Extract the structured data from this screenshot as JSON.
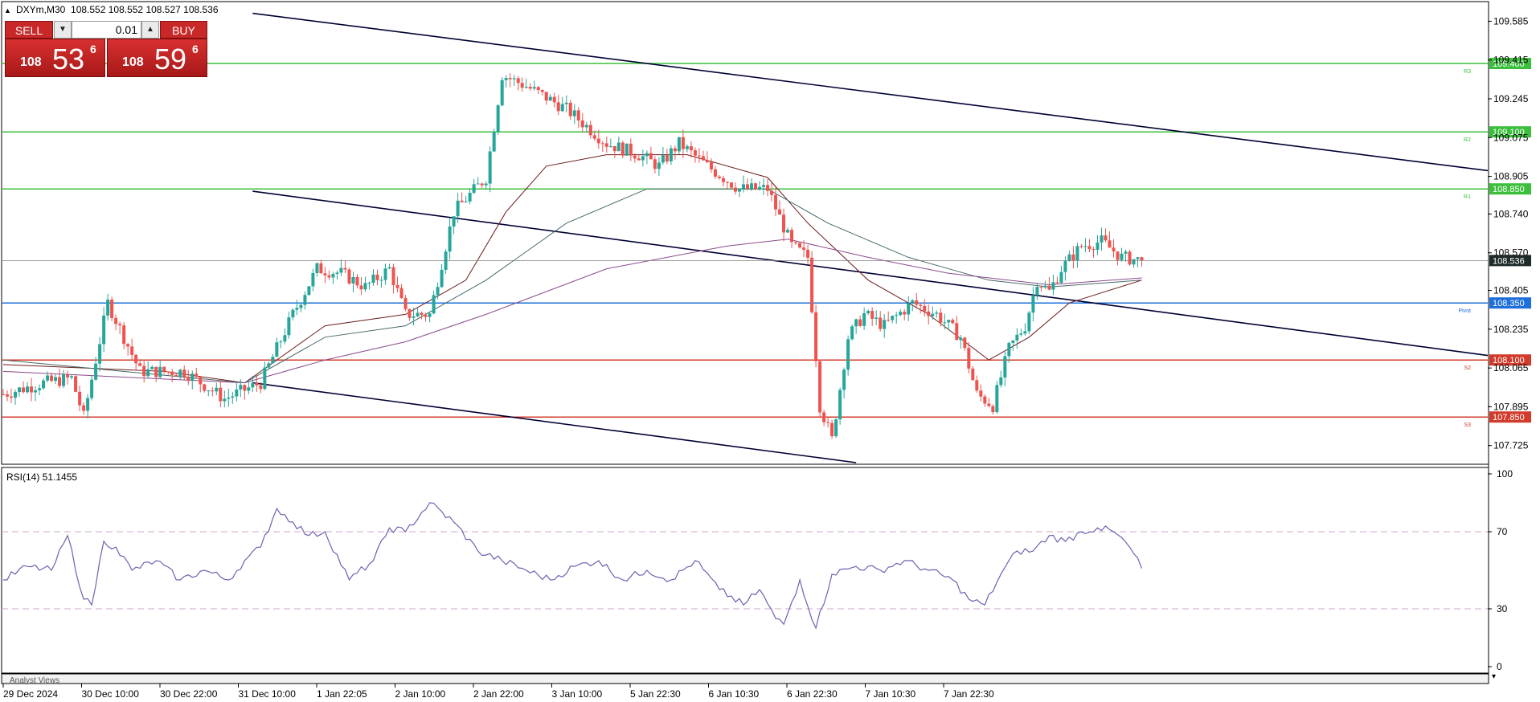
{
  "symbol_header": "DXYm,M30  108.552 108.552 108.527 108.536",
  "trade_panel": {
    "sell_label": "SELL",
    "buy_label": "BUY",
    "lot_value": "0.01",
    "sell_price": {
      "small": "108",
      "big": "53",
      "sup": "6"
    },
    "buy_price": {
      "small": "108",
      "big": "59",
      "sup": "6"
    }
  },
  "colors": {
    "bull_candle": "#26a69a",
    "bear_candle": "#ef5350",
    "resistance": "#3cbf3c",
    "support": "#d23b2b",
    "pivot": "#1e6fd9",
    "channel": "#000033",
    "rsi": "#7060b0"
  },
  "chart_data": [
    {
      "type": "candlestick",
      "timeframe": "M30",
      "ylim": [
        107.65,
        109.65
      ],
      "y_ticks": [
        "109.585",
        "109.415",
        "109.245",
        "109.075",
        "108.905",
        "108.740",
        "108.570",
        "108.405",
        "108.235",
        "108.065",
        "107.895",
        "107.725"
      ],
      "x_ticks": [
        "29 Dec 2024",
        "30 Dec 10:00",
        "30 Dec 22:00",
        "31 Dec 10:00",
        "1 Jan 22:05",
        "2 Jan 10:00",
        "2 Jan 22:00",
        "3 Jan 10:00",
        "5 Jan 22:30",
        "6 Jan 10:30",
        "6 Jan 22:30",
        "7 Jan 10:30",
        "7 Jan 22:30"
      ],
      "current_price": "108.536",
      "levels": [
        {
          "tag": "R3",
          "value": 109.4,
          "label": "109.400",
          "kind": "resistance"
        },
        {
          "tag": "R2",
          "value": 109.1,
          "label": "109.100",
          "kind": "resistance"
        },
        {
          "tag": "R1",
          "value": 108.85,
          "label": "108.850",
          "kind": "resistance"
        },
        {
          "tag": "Pivot",
          "value": 108.35,
          "label": "108.350",
          "kind": "pivot"
        },
        {
          "tag": "S2",
          "value": 108.1,
          "label": "108.100",
          "kind": "support"
        },
        {
          "tag": "S3",
          "value": 107.85,
          "label": "107.850",
          "kind": "support"
        }
      ],
      "key_closes": [
        {
          "t": 0,
          "v": 107.95
        },
        {
          "t": 10,
          "v": 108.0
        },
        {
          "t": 17,
          "v": 108.02
        },
        {
          "t": 20,
          "v": 107.85
        },
        {
          "t": 26,
          "v": 108.35
        },
        {
          "t": 34,
          "v": 108.05
        },
        {
          "t": 45,
          "v": 108.05
        },
        {
          "t": 55,
          "v": 107.93
        },
        {
          "t": 64,
          "v": 108.0
        },
        {
          "t": 72,
          "v": 108.3
        },
        {
          "t": 78,
          "v": 108.5
        },
        {
          "t": 84,
          "v": 108.48
        },
        {
          "t": 90,
          "v": 108.42
        },
        {
          "t": 96,
          "v": 108.5
        },
        {
          "t": 100,
          "v": 108.3
        },
        {
          "t": 106,
          "v": 108.3
        },
        {
          "t": 112,
          "v": 108.75
        },
        {
          "t": 120,
          "v": 108.9
        },
        {
          "t": 124,
          "v": 109.35
        },
        {
          "t": 130,
          "v": 109.3
        },
        {
          "t": 140,
          "v": 109.2
        },
        {
          "t": 150,
          "v": 109.05
        },
        {
          "t": 158,
          "v": 109.0
        },
        {
          "t": 163,
          "v": 108.95
        },
        {
          "t": 168,
          "v": 109.05
        },
        {
          "t": 175,
          "v": 108.95
        },
        {
          "t": 183,
          "v": 108.85
        },
        {
          "t": 190,
          "v": 108.85
        },
        {
          "t": 196,
          "v": 108.6
        },
        {
          "t": 200,
          "v": 108.55
        },
        {
          "t": 203,
          "v": 107.9
        },
        {
          "t": 206,
          "v": 107.75
        },
        {
          "t": 210,
          "v": 108.2
        },
        {
          "t": 214,
          "v": 108.3
        },
        {
          "t": 219,
          "v": 108.25
        },
        {
          "t": 226,
          "v": 108.35
        },
        {
          "t": 232,
          "v": 108.3
        },
        {
          "t": 238,
          "v": 108.2
        },
        {
          "t": 242,
          "v": 107.95
        },
        {
          "t": 246,
          "v": 107.9
        },
        {
          "t": 250,
          "v": 108.15
        },
        {
          "t": 254,
          "v": 108.25
        },
        {
          "t": 257,
          "v": 108.45
        },
        {
          "t": 260,
          "v": 108.4
        },
        {
          "t": 263,
          "v": 108.5
        },
        {
          "t": 268,
          "v": 108.6
        },
        {
          "t": 273,
          "v": 108.62
        },
        {
          "t": 278,
          "v": 108.55
        },
        {
          "t": 283,
          "v": 108.536
        }
      ],
      "moving_averages": [
        {
          "name": "",
          "color": "#6b1c1c",
          "points": [
            {
              "t": 0,
              "v": 108.08
            },
            {
              "t": 40,
              "v": 108.05
            },
            {
              "t": 60,
              "v": 108.0
            },
            {
              "t": 80,
              "v": 108.25
            },
            {
              "t": 100,
              "v": 108.3
            },
            {
              "t": 115,
              "v": 108.45
            },
            {
              "t": 125,
              "v": 108.75
            },
            {
              "t": 135,
              "v": 108.95
            },
            {
              "t": 150,
              "v": 109.0
            },
            {
              "t": 170,
              "v": 109.0
            },
            {
              "t": 190,
              "v": 108.9
            },
            {
              "t": 200,
              "v": 108.7
            },
            {
              "t": 215,
              "v": 108.45
            },
            {
              "t": 230,
              "v": 108.3
            },
            {
              "t": 245,
              "v": 108.1
            },
            {
              "t": 255,
              "v": 108.2
            },
            {
              "t": 265,
              "v": 108.35
            },
            {
              "t": 283,
              "v": 108.45
            }
          ]
        },
        {
          "name": "",
          "color": "#4a6a6a",
          "points": [
            {
              "t": 0,
              "v": 108.1
            },
            {
              "t": 60,
              "v": 108.0
            },
            {
              "t": 80,
              "v": 108.2
            },
            {
              "t": 100,
              "v": 108.25
            },
            {
              "t": 120,
              "v": 108.45
            },
            {
              "t": 140,
              "v": 108.7
            },
            {
              "t": 160,
              "v": 108.85
            },
            {
              "t": 190,
              "v": 108.85
            },
            {
              "t": 205,
              "v": 108.7
            },
            {
              "t": 225,
              "v": 108.55
            },
            {
              "t": 245,
              "v": 108.45
            },
            {
              "t": 260,
              "v": 108.42
            },
            {
              "t": 283,
              "v": 108.45
            }
          ]
        },
        {
          "name": "",
          "color": "#8a4a8a",
          "points": [
            {
              "t": 0,
              "v": 108.05
            },
            {
              "t": 60,
              "v": 108.0
            },
            {
              "t": 80,
              "v": 108.1
            },
            {
              "t": 100,
              "v": 108.18
            },
            {
              "t": 120,
              "v": 108.3
            },
            {
              "t": 150,
              "v": 108.5
            },
            {
              "t": 180,
              "v": 108.6
            },
            {
              "t": 195,
              "v": 108.63
            },
            {
              "t": 215,
              "v": 108.55
            },
            {
              "t": 235,
              "v": 108.48
            },
            {
              "t": 260,
              "v": 108.43
            },
            {
              "t": 283,
              "v": 108.46
            }
          ]
        }
      ],
      "channel_lines": [
        {
          "from": {
            "t": 62,
            "v": 109.62
          },
          "to": {
            "t": 369,
            "v": 108.93
          }
        },
        {
          "from": {
            "t": 62,
            "v": 108.84
          },
          "to": {
            "t": 369,
            "v": 108.12
          }
        },
        {
          "from": {
            "t": 62,
            "v": 108.0
          },
          "to": {
            "t": 212,
            "v": 107.65
          }
        }
      ]
    },
    {
      "type": "line",
      "title": "RSI(14) 51.1455",
      "ylim": [
        0,
        100
      ],
      "y_ticks": [
        "100",
        "70",
        "30",
        "0"
      ],
      "levels": [
        70,
        30
      ],
      "points": [
        {
          "t": 0,
          "v": 45
        },
        {
          "t": 6,
          "v": 52
        },
        {
          "t": 12,
          "v": 50
        },
        {
          "t": 16,
          "v": 68
        },
        {
          "t": 20,
          "v": 35
        },
        {
          "t": 22,
          "v": 32
        },
        {
          "t": 25,
          "v": 65
        },
        {
          "t": 28,
          "v": 62
        },
        {
          "t": 32,
          "v": 50
        },
        {
          "t": 38,
          "v": 55
        },
        {
          "t": 44,
          "v": 45
        },
        {
          "t": 50,
          "v": 50
        },
        {
          "t": 56,
          "v": 45
        },
        {
          "t": 60,
          "v": 55
        },
        {
          "t": 64,
          "v": 62
        },
        {
          "t": 68,
          "v": 82
        },
        {
          "t": 72,
          "v": 75
        },
        {
          "t": 76,
          "v": 68
        },
        {
          "t": 80,
          "v": 70
        },
        {
          "t": 86,
          "v": 45
        },
        {
          "t": 92,
          "v": 55
        },
        {
          "t": 96,
          "v": 72
        },
        {
          "t": 100,
          "v": 70
        },
        {
          "t": 106,
          "v": 85
        },
        {
          "t": 112,
          "v": 75
        },
        {
          "t": 118,
          "v": 60
        },
        {
          "t": 124,
          "v": 55
        },
        {
          "t": 130,
          "v": 50
        },
        {
          "t": 136,
          "v": 45
        },
        {
          "t": 142,
          "v": 52
        },
        {
          "t": 148,
          "v": 55
        },
        {
          "t": 154,
          "v": 45
        },
        {
          "t": 160,
          "v": 50
        },
        {
          "t": 166,
          "v": 45
        },
        {
          "t": 172,
          "v": 55
        },
        {
          "t": 178,
          "v": 40
        },
        {
          "t": 184,
          "v": 32
        },
        {
          "t": 188,
          "v": 40
        },
        {
          "t": 192,
          "v": 25
        },
        {
          "t": 194,
          "v": 22
        },
        {
          "t": 198,
          "v": 45
        },
        {
          "t": 202,
          "v": 20
        },
        {
          "t": 206,
          "v": 48
        },
        {
          "t": 212,
          "v": 52
        },
        {
          "t": 218,
          "v": 50
        },
        {
          "t": 224,
          "v": 55
        },
        {
          "t": 230,
          "v": 50
        },
        {
          "t": 236,
          "v": 45
        },
        {
          "t": 240,
          "v": 35
        },
        {
          "t": 244,
          "v": 32
        },
        {
          "t": 248,
          "v": 48
        },
        {
          "t": 252,
          "v": 60
        },
        {
          "t": 256,
          "v": 60
        },
        {
          "t": 260,
          "v": 68
        },
        {
          "t": 264,
          "v": 65
        },
        {
          "t": 268,
          "v": 70
        },
        {
          "t": 272,
          "v": 72
        },
        {
          "t": 276,
          "v": 70
        },
        {
          "t": 280,
          "v": 62
        },
        {
          "t": 283,
          "v": 51
        }
      ]
    }
  ],
  "footer_label": "Analyst Views"
}
